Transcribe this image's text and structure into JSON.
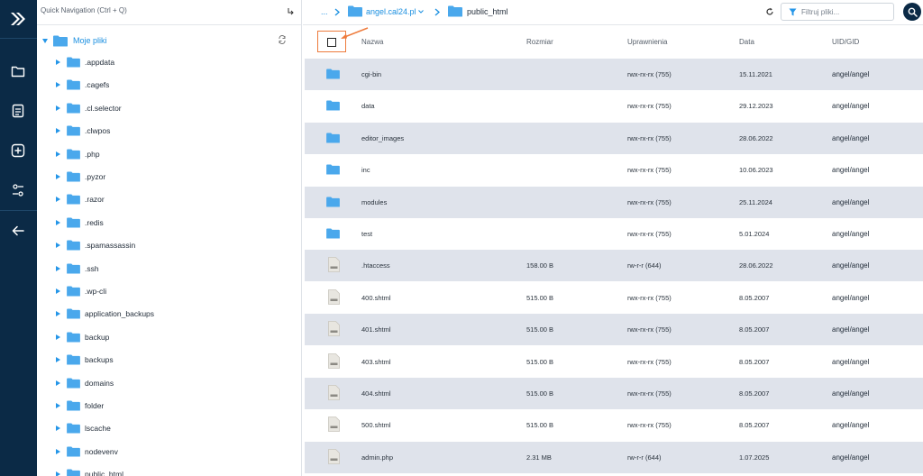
{
  "colors": {
    "rail_bg": "#0b2a46",
    "accent": "#2596e8",
    "folder": "#4aa8ec",
    "row_shade": "#dfe3eb",
    "annotation": "#ee7b3c"
  },
  "rail": {
    "icons": [
      "logo-icon",
      "folder-icon",
      "document-icon",
      "add-icon",
      "settings-sliders-icon",
      "back-arrow-icon"
    ]
  },
  "tree": {
    "quick_nav_placeholder": "Quick Navigation (Ctrl + Q)",
    "root_label": "Moje pliki",
    "items": [
      ".appdata",
      ".cagefs",
      ".cl.selector",
      ".clwpos",
      ".php",
      ".pyzor",
      ".razor",
      ".redis",
      ".spamassassin",
      ".ssh",
      ".wp-cli",
      "application_backups",
      "backup",
      "backups",
      "domains",
      "folder",
      "lscache",
      "nodevenv",
      "public_html"
    ]
  },
  "breadcrumb": {
    "ellipsis": "...",
    "domain": "angel.cal24.pl",
    "current": "public_html"
  },
  "toolbar": {
    "filter_placeholder": "Filtruj pliki..."
  },
  "table": {
    "headers": {
      "name": "Nazwa",
      "size": "Rozmiar",
      "perm": "Uprawnienia",
      "date": "Data",
      "uid": "UID/GID"
    },
    "rows": [
      {
        "type": "folder",
        "name": "cgi-bin",
        "size": "",
        "perm": "rwx-rx-rx (755)",
        "date": "15.11.2021",
        "uid": "angel/angel"
      },
      {
        "type": "folder",
        "name": "data",
        "size": "",
        "perm": "rwx-rx-rx (755)",
        "date": "29.12.2023",
        "uid": "angel/angel"
      },
      {
        "type": "folder",
        "name": "editor_images",
        "size": "",
        "perm": "rwx-rx-rx (755)",
        "date": "28.06.2022",
        "uid": "angel/angel"
      },
      {
        "type": "folder",
        "name": "inc",
        "size": "",
        "perm": "rwx-rx-rx (755)",
        "date": "10.06.2023",
        "uid": "angel/angel"
      },
      {
        "type": "folder",
        "name": "modules",
        "size": "",
        "perm": "rwx-rx-rx (755)",
        "date": "25.11.2024",
        "uid": "angel/angel"
      },
      {
        "type": "folder",
        "name": "test",
        "size": "",
        "perm": "rwx-rx-rx (755)",
        "date": "5.01.2024",
        "uid": "angel/angel"
      },
      {
        "type": "file",
        "name": ".htaccess",
        "size": "158.00 B",
        "perm": "rw-r-r (644)",
        "date": "28.06.2022",
        "uid": "angel/angel"
      },
      {
        "type": "file",
        "name": "400.shtml",
        "size": "515.00 B",
        "perm": "rwx-rx-rx (755)",
        "date": "8.05.2007",
        "uid": "angel/angel"
      },
      {
        "type": "file",
        "name": "401.shtml",
        "size": "515.00 B",
        "perm": "rwx-rx-rx (755)",
        "date": "8.05.2007",
        "uid": "angel/angel"
      },
      {
        "type": "file",
        "name": "403.shtml",
        "size": "515.00 B",
        "perm": "rwx-rx-rx (755)",
        "date": "8.05.2007",
        "uid": "angel/angel"
      },
      {
        "type": "file",
        "name": "404.shtml",
        "size": "515.00 B",
        "perm": "rwx-rx-rx (755)",
        "date": "8.05.2007",
        "uid": "angel/angel"
      },
      {
        "type": "file",
        "name": "500.shtml",
        "size": "515.00 B",
        "perm": "rwx-rx-rx (755)",
        "date": "8.05.2007",
        "uid": "angel/angel"
      },
      {
        "type": "file",
        "name": "admin.php",
        "size": "2.31 MB",
        "perm": "rw-r-r (644)",
        "date": "1.07.2025",
        "uid": "angel/angel"
      }
    ]
  }
}
